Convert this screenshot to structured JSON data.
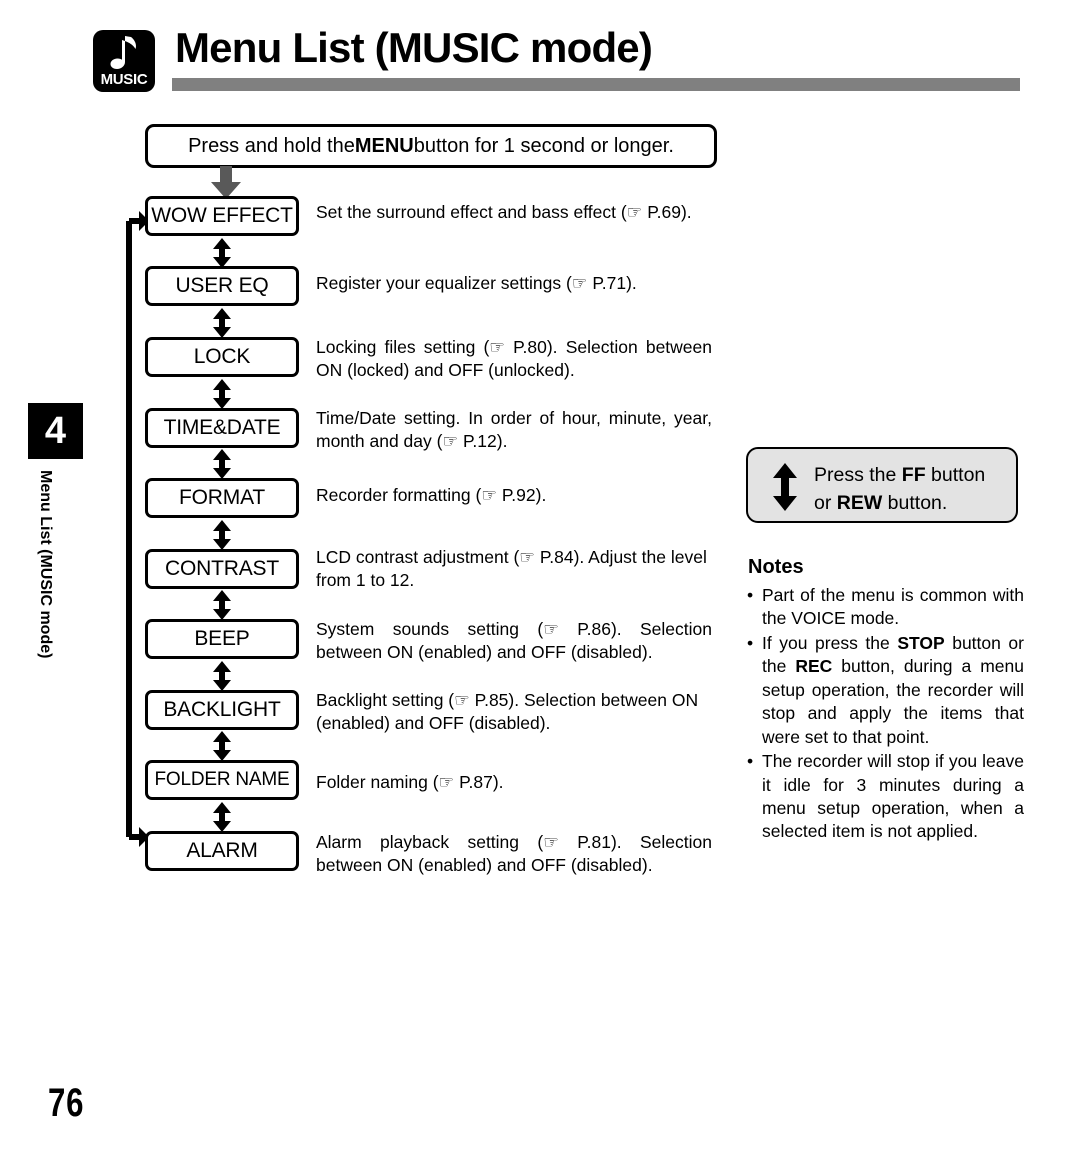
{
  "header": {
    "badge_label": "MUSIC",
    "badge_icon": "music-note-icon",
    "title": "Menu List (MUSIC mode)"
  },
  "side_tab": {
    "chapter_number": "4",
    "running_title": "Menu List (MUSIC mode)"
  },
  "intro": {
    "text_before": "Press and hold the ",
    "bold": "MENU",
    "text_after": " button for 1 second or longer."
  },
  "flow": {
    "arrow_color": "#595959",
    "items": [
      {
        "label": "WOW EFFECT",
        "description": "Set the surround effect and bass effect (☞ P.69).",
        "page_ref": "P.69"
      },
      {
        "label": "USER EQ",
        "description": "Register your equalizer settings (☞ P.71).",
        "page_ref": "P.71"
      },
      {
        "label": "LOCK",
        "description": "Locking files setting (☞ P.80). Selection between ON (locked) and OFF (unlocked).",
        "page_ref": "P.80"
      },
      {
        "label": "TIME&DATE",
        "description": "Time/Date setting. In order of hour, minute, year, month and day (☞ P.12).",
        "page_ref": "P.12"
      },
      {
        "label": "FORMAT",
        "description": "Recorder formatting (☞ P.92).",
        "page_ref": "P.92"
      },
      {
        "label": "CONTRAST",
        "description": "LCD contrast adjustment (☞ P.84). Adjust the level from 1 to 12.",
        "page_ref": "P.84"
      },
      {
        "label": "BEEP",
        "description": "System sounds setting (☞ P.86). Selection between ON (enabled) and OFF (disabled).",
        "page_ref": "P.86"
      },
      {
        "label": "BACKLIGHT",
        "description": "Backlight setting (☞ P.85). Selection between ON (enabled) and OFF (disabled).",
        "page_ref": "P.85"
      },
      {
        "label": "FOLDER NAME",
        "description": "Folder naming (☞ P.87).",
        "page_ref": "P.87"
      },
      {
        "label": "ALARM",
        "description": "Alarm playback setting (☞ P.81). Selection between ON (enabled) and OFF (disabled).",
        "page_ref": "P.81"
      }
    ]
  },
  "callout": {
    "background": "#e3e3e3",
    "line1_pre": "Press the ",
    "line1_bold": "FF",
    "line1_post": " button",
    "line2_pre": "or ",
    "line2_bold": "REW",
    "line2_post": " button."
  },
  "notes": {
    "title": "Notes",
    "bullet": "•",
    "items": [
      {
        "parts": [
          {
            "text": "Part of the menu is common with the VOICE mode.",
            "bold": false
          }
        ]
      },
      {
        "parts": [
          {
            "text": "If you press the ",
            "bold": false
          },
          {
            "text": "STOP",
            "bold": true
          },
          {
            "text": " button or the ",
            "bold": false
          },
          {
            "text": "REC",
            "bold": true
          },
          {
            "text": " button, during a menu setup operation, the recorder will stop and apply the items that were set to that point.",
            "bold": false
          }
        ]
      },
      {
        "parts": [
          {
            "text": "The recorder will stop if you leave it idle for 3 minutes during a menu setup operation, when a selected item is not applied.",
            "bold": false
          }
        ]
      }
    ]
  },
  "footer": {
    "page_number": "76"
  }
}
